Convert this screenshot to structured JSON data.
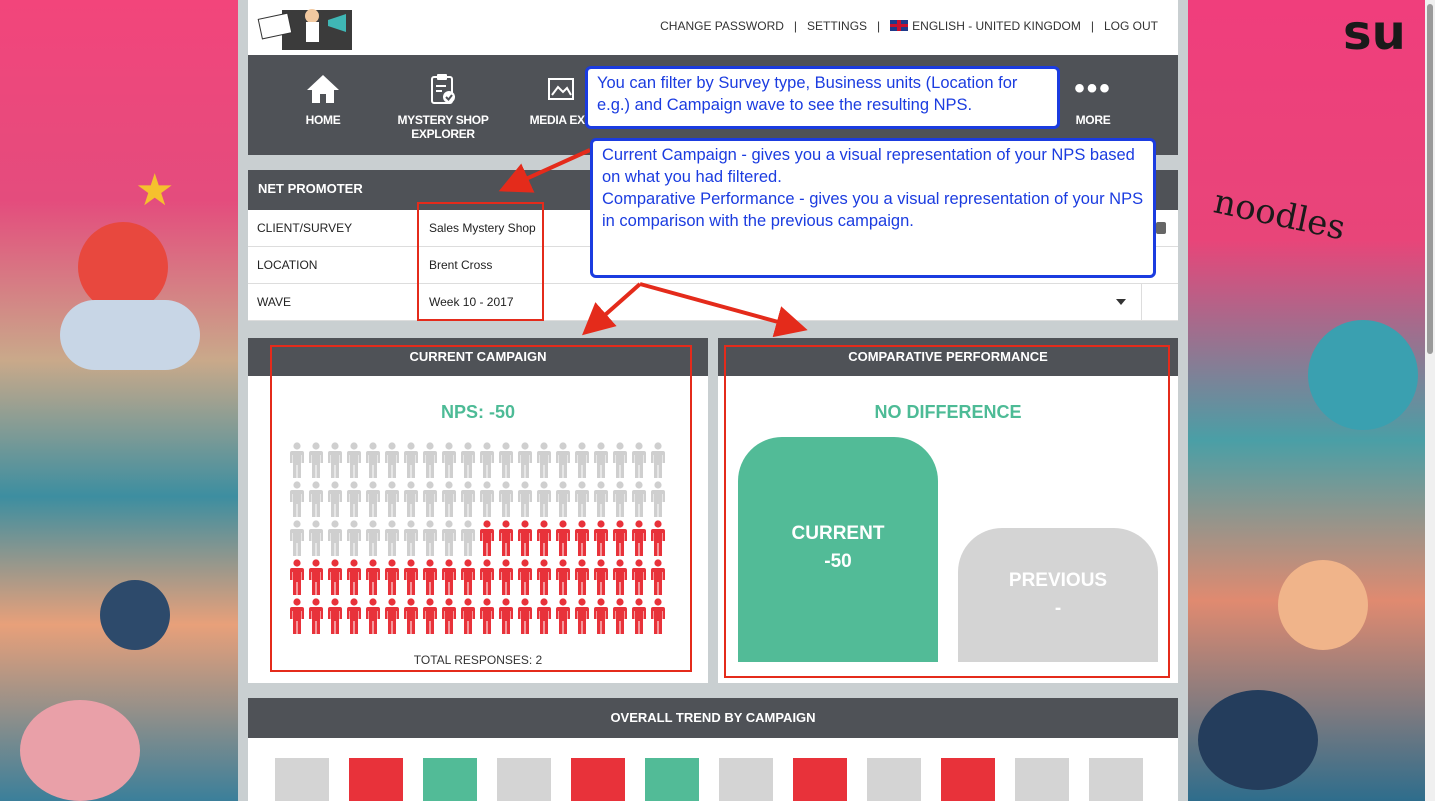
{
  "topbar": {
    "logo_alt": "LIVE DEMO",
    "links": {
      "change_password": "CHANGE PASSWORD",
      "settings": "SETTINGS",
      "language": "ENGLISH - UNITED KINGDOM",
      "logout": "LOG OUT"
    },
    "separator": "|"
  },
  "nav": {
    "items": [
      {
        "label": "HOME",
        "icon": "home-icon"
      },
      {
        "label": "MYSTERY SHOP EXPLORER",
        "icon": "clipboard-check-icon"
      },
      {
        "label": "MEDIA EXP",
        "icon": "media-icon"
      },
      {
        "label": "MORE",
        "icon": "more-dots-icon"
      }
    ]
  },
  "callouts": {
    "filter_note": "You can filter by Survey type, Business units (Location for e.g.) and Campaign wave to see the resulting NPS.",
    "campaign_note_1": "Current Campaign - gives you a visual representation of your NPS based on what you had filtered.",
    "campaign_note_2": "Comparative Performance - gives you a visual representation of your NPS in comparison with the previous campaign."
  },
  "net_promoter": {
    "title": "NET PROMOTER",
    "filters": [
      {
        "label": "CLIENT/SURVEY",
        "value": "Sales Mystery Shop"
      },
      {
        "label": "LOCATION",
        "value": "Brent Cross"
      },
      {
        "label": "WAVE",
        "value": "Week 10 - 2017"
      }
    ]
  },
  "current_campaign": {
    "title": "CURRENT CAMPAIGN",
    "nps_label": "NPS: -50",
    "total_responses": "TOTAL RESPONSES: 2",
    "people": {
      "columns": 20,
      "rows": 5,
      "grey_count": 50,
      "red_count": 50
    },
    "colors": {
      "grey": "#cfcfcf",
      "red": "#e8323a"
    }
  },
  "comparative": {
    "title": "COMPARATIVE PERFORMANCE",
    "status": "NO DIFFERENCE",
    "current": {
      "label": "CURRENT",
      "value": "-50",
      "color": "#52bb97"
    },
    "previous": {
      "label": "PREVIOUS",
      "value": "-",
      "color": "#d4d4d4"
    }
  },
  "trend": {
    "title": "OVERALL TREND BY CAMPAIGN",
    "squares": [
      "#d4d4d4",
      "#e8323a",
      "#52bb97",
      "#d4d4d4",
      "#e8323a",
      "#52bb97",
      "#d4d4d4",
      "#e8323a",
      "#d4d4d4",
      "#e8323a",
      "#d4d4d4",
      "#d4d4d4"
    ]
  }
}
